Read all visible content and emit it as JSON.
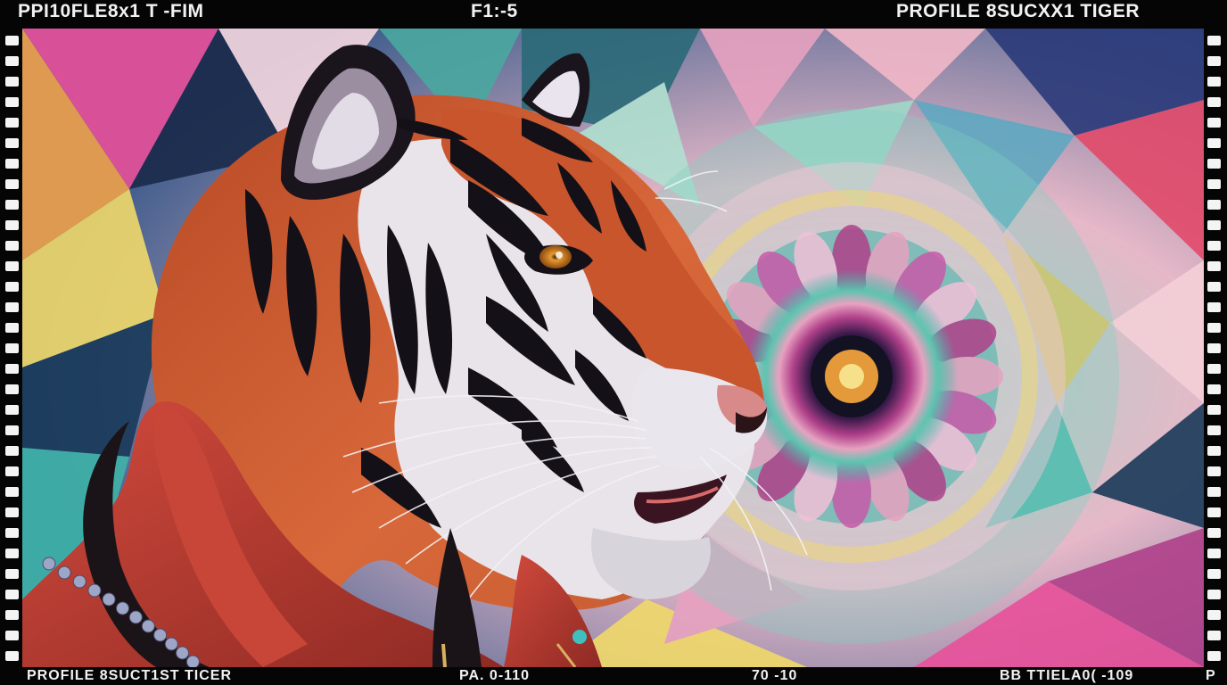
{
  "header": {
    "left_text": "PPI10FLE8x1   T -FIM",
    "center_text": "F1:-5",
    "right_text": "PROFILE 8SUCXX1 TIGER"
  },
  "footer": {
    "left_text": "PROFILE 8SUCT1ST TICER",
    "center_left_text": "PA. 0-110",
    "center_right_text": "70 -10",
    "right_text": "BB TTIELA0( -109",
    "far_right_text": "P"
  },
  "image": {
    "subject": "tiger in red leather jacket, side profile",
    "background": "kaleidoscope geometric mandala",
    "colors": {
      "tiger_orange": "#c8552c",
      "tiger_white": "#e8e4ea",
      "stripe": "#141018",
      "jacket_red": "#b83a30",
      "eye": "#e89a30",
      "teal": "#3fb3a8",
      "magenta": "#b0408a",
      "pink": "#e7a2c0",
      "yellow": "#f1d96a",
      "navy": "#1a2a4a"
    }
  }
}
